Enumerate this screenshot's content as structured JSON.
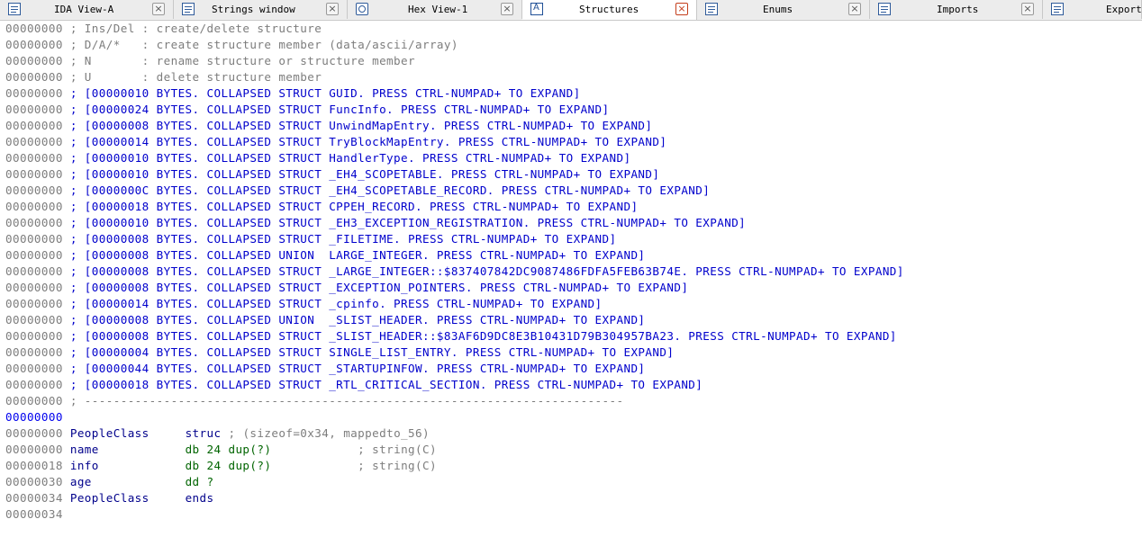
{
  "tabs": [
    {
      "label": "IDA View-A",
      "icon": "ida-view-icon",
      "active": false
    },
    {
      "label": "Strings window",
      "icon": "strings-icon",
      "active": false
    },
    {
      "label": "Hex View-1",
      "icon": "hex-view-icon",
      "active": false
    },
    {
      "label": "Structures",
      "icon": "structures-icon",
      "active": true
    },
    {
      "label": "Enums",
      "icon": "enums-icon",
      "active": false
    },
    {
      "label": "Imports",
      "icon": "imports-icon",
      "active": false
    },
    {
      "label": "Exports",
      "icon": "exports-icon",
      "active": false
    }
  ],
  "tab_close_glyph": "×",
  "help_lines": [
    {
      "addr": "00000000",
      "text": "; Ins/Del : create/delete structure"
    },
    {
      "addr": "00000000",
      "text": "; D/A/*   : create structure member (data/ascii/array)"
    },
    {
      "addr": "00000000",
      "text": "; N       : rename structure or structure member"
    },
    {
      "addr": "00000000",
      "text": "; U       : delete structure member"
    }
  ],
  "collapsed_lines": [
    {
      "addr": "00000000",
      "text": "; [00000010 BYTES. COLLAPSED STRUCT GUID. PRESS CTRL-NUMPAD+ TO EXPAND]"
    },
    {
      "addr": "00000000",
      "text": "; [00000024 BYTES. COLLAPSED STRUCT FuncInfo. PRESS CTRL-NUMPAD+ TO EXPAND]"
    },
    {
      "addr": "00000000",
      "text": "; [00000008 BYTES. COLLAPSED STRUCT UnwindMapEntry. PRESS CTRL-NUMPAD+ TO EXPAND]"
    },
    {
      "addr": "00000000",
      "text": "; [00000014 BYTES. COLLAPSED STRUCT TryBlockMapEntry. PRESS CTRL-NUMPAD+ TO EXPAND]"
    },
    {
      "addr": "00000000",
      "text": "; [00000010 BYTES. COLLAPSED STRUCT HandlerType. PRESS CTRL-NUMPAD+ TO EXPAND]"
    },
    {
      "addr": "00000000",
      "text": "; [00000010 BYTES. COLLAPSED STRUCT _EH4_SCOPETABLE. PRESS CTRL-NUMPAD+ TO EXPAND]"
    },
    {
      "addr": "00000000",
      "text": "; [0000000C BYTES. COLLAPSED STRUCT _EH4_SCOPETABLE_RECORD. PRESS CTRL-NUMPAD+ TO EXPAND]"
    },
    {
      "addr": "00000000",
      "text": "; [00000018 BYTES. COLLAPSED STRUCT CPPEH_RECORD. PRESS CTRL-NUMPAD+ TO EXPAND]"
    },
    {
      "addr": "00000000",
      "text": "; [00000010 BYTES. COLLAPSED STRUCT _EH3_EXCEPTION_REGISTRATION. PRESS CTRL-NUMPAD+ TO EXPAND]"
    },
    {
      "addr": "00000000",
      "text": "; [00000008 BYTES. COLLAPSED STRUCT _FILETIME. PRESS CTRL-NUMPAD+ TO EXPAND]"
    },
    {
      "addr": "00000000",
      "text": "; [00000008 BYTES. COLLAPSED UNION  LARGE_INTEGER. PRESS CTRL-NUMPAD+ TO EXPAND]"
    },
    {
      "addr": "00000000",
      "text": "; [00000008 BYTES. COLLAPSED STRUCT _LARGE_INTEGER::$837407842DC9087486FDFA5FEB63B74E. PRESS CTRL-NUMPAD+ TO EXPAND]"
    },
    {
      "addr": "00000000",
      "text": "; [00000008 BYTES. COLLAPSED STRUCT _EXCEPTION_POINTERS. PRESS CTRL-NUMPAD+ TO EXPAND]"
    },
    {
      "addr": "00000000",
      "text": "; [00000014 BYTES. COLLAPSED STRUCT _cpinfo. PRESS CTRL-NUMPAD+ TO EXPAND]"
    },
    {
      "addr": "00000000",
      "text": "; [00000008 BYTES. COLLAPSED UNION  _SLIST_HEADER. PRESS CTRL-NUMPAD+ TO EXPAND]"
    },
    {
      "addr": "00000000",
      "text": "; [00000008 BYTES. COLLAPSED STRUCT _SLIST_HEADER::$83AF6D9DC8E3B10431D79B304957BA23. PRESS CTRL-NUMPAD+ TO EXPAND]"
    },
    {
      "addr": "00000000",
      "text": "; [00000004 BYTES. COLLAPSED STRUCT SINGLE_LIST_ENTRY. PRESS CTRL-NUMPAD+ TO EXPAND]"
    },
    {
      "addr": "00000000",
      "text": "; [00000044 BYTES. COLLAPSED STRUCT _STARTUPINFOW. PRESS CTRL-NUMPAD+ TO EXPAND]"
    },
    {
      "addr": "00000000",
      "text": "; [00000018 BYTES. COLLAPSED STRUCT _RTL_CRITICAL_SECTION. PRESS CTRL-NUMPAD+ TO EXPAND]"
    }
  ],
  "separator": {
    "addr": "00000000",
    "text": "; ---------------------------------------------------------------------------"
  },
  "cursor_line": {
    "addr": "00000000"
  },
  "struct": {
    "header": {
      "addr": "00000000",
      "name": "PeopleClass",
      "keyword": "struc",
      "comment": "; (sizeof=0x34, mappedto_56)"
    },
    "members": [
      {
        "addr": "00000000",
        "name": "name",
        "def": "db 24 dup(?)",
        "comment": "; string(C)"
      },
      {
        "addr": "00000018",
        "name": "info",
        "def": "db 24 dup(?)",
        "comment": "; string(C)"
      },
      {
        "addr": "00000030",
        "name": "age",
        "def": "dd ?",
        "comment": ""
      }
    ],
    "footer": {
      "addr": "00000034",
      "name": "PeopleClass",
      "keyword": "ends"
    }
  },
  "end_line": {
    "addr": "00000034"
  },
  "colors": {
    "address": "#7d7d7d",
    "cursor_address": "#0000ee",
    "comment": "#7d7d7d",
    "collapsed": "#0000cc",
    "identifier": "#00008b",
    "data_def": "#006400",
    "close_active": "#c43e1c"
  }
}
